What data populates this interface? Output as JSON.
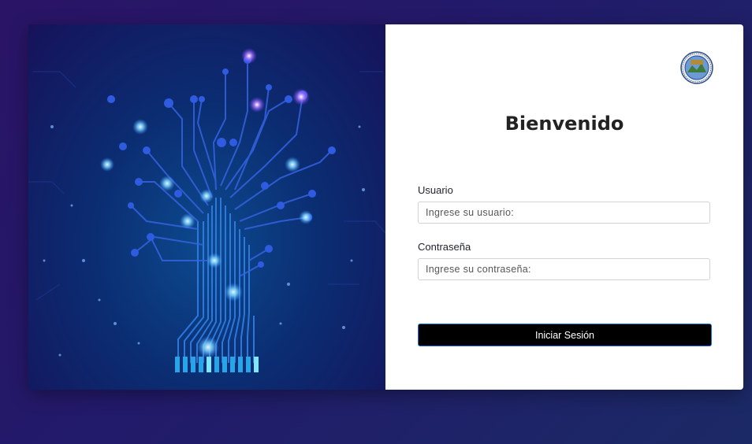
{
  "login": {
    "title": "Bienvenido",
    "user_label": "Usuario",
    "user_placeholder": "Ingrese su usuario:",
    "user_value": "",
    "password_label": "Contraseña",
    "password_placeholder": "Ingrese su contraseña:",
    "password_value": "",
    "submit_label": "Iniciar Sesión"
  },
  "icons": {
    "seal": "university-seal-logo",
    "hero": "circuit-tree-illustration"
  },
  "colors": {
    "page_bg": "#2a1466",
    "hero_bg": "#0b2d72",
    "circuit": "#3a8dff",
    "glow": "#7fd8ff",
    "button_bg": "#000000",
    "button_border": "#1f6fd6"
  }
}
